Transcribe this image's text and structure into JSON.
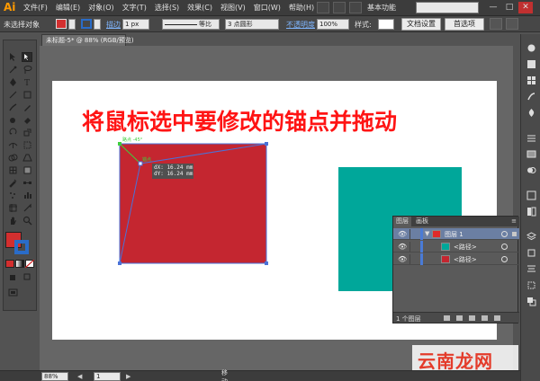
{
  "app": {
    "logo": "Ai",
    "menus": [
      "文件(F)",
      "编辑(E)",
      "对象(O)",
      "文字(T)",
      "选择(S)",
      "效果(C)",
      "视图(V)",
      "窗口(W)",
      "帮助(H)"
    ],
    "workspace": "基本功能",
    "window_controls": [
      "—",
      "□",
      "✕"
    ]
  },
  "control_bar": {
    "selection_status": "未选择对象",
    "fill_color": "#d32f2f",
    "stroke_color": "#2a6cc8",
    "stroke_label": "描边",
    "stroke_weight": "1 px",
    "stroke_profile": "等比",
    "brush": "3 点圆形",
    "opacity_label": "不透明度",
    "opacity_value": "100%",
    "style_label": "样式:",
    "doc_setup_button": "文档设置",
    "prefs_button": "首选项"
  },
  "document_tab": {
    "title": "未标题-5* @ 88% (RGB/预览)"
  },
  "canvas": {
    "headline": "将鼠标选中要修改的锚点并拖动",
    "red_shape_color": "#c42630",
    "teal_shape_color": "#00a79a",
    "guide_label": "路点 -45°",
    "anchor_label": "锚点",
    "tooltip_dx": "dX: 16.24 mm",
    "tooltip_dy": "dY: 16.24 mm"
  },
  "layers_panel": {
    "tab_layers": "图层",
    "tab_artboards": "画板",
    "rows": [
      {
        "name": "图层 1",
        "thumb_color": "#e02a2a",
        "type": "layer"
      },
      {
        "name": "<路径>",
        "thumb_color": "#00a79a",
        "type": "path"
      },
      {
        "name": "<路径>",
        "thumb_color": "#c42630",
        "type": "path"
      }
    ],
    "footer_count": "1 个图层"
  },
  "status_bar": {
    "zoom": "88%",
    "page": "1",
    "current_tool": "移动"
  },
  "watermark": {
    "text": "云南龙网",
    "color": "#e43b2a"
  }
}
